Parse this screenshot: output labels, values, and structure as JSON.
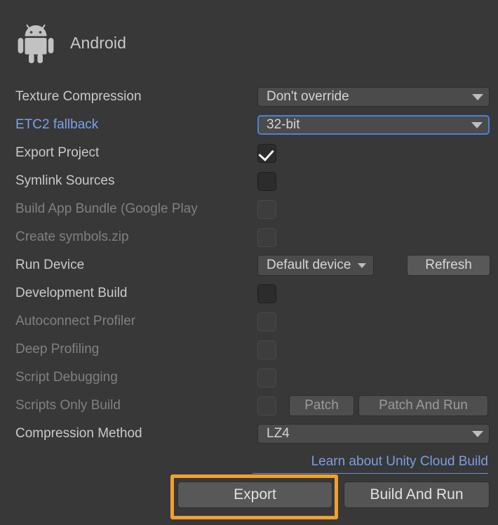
{
  "header": {
    "icon": "android-robot-icon",
    "title": "Android"
  },
  "settings": [
    {
      "label": "Texture Compression",
      "type": "dropdown",
      "value": "Don't override",
      "disabled": false,
      "label_style": "normal",
      "focused": false
    },
    {
      "label": "ETC2 fallback",
      "type": "dropdown",
      "value": "32-bit",
      "disabled": false,
      "label_style": "link",
      "focused": true
    },
    {
      "label": "Export Project",
      "type": "checkbox",
      "checked": true,
      "disabled": false,
      "label_style": "normal"
    },
    {
      "label": "Symlink Sources",
      "type": "checkbox",
      "checked": false,
      "disabled": false,
      "label_style": "normal"
    },
    {
      "label": "Build App Bundle (Google Play",
      "type": "checkbox",
      "checked": false,
      "disabled": true,
      "label_style": "disabled"
    },
    {
      "label": "Create symbols.zip",
      "type": "checkbox",
      "checked": false,
      "disabled": true,
      "label_style": "disabled"
    },
    {
      "label": "Run Device",
      "type": "device",
      "value": "Default device",
      "button": "Refresh",
      "disabled": false,
      "label_style": "normal"
    },
    {
      "label": "Development Build",
      "type": "checkbox",
      "checked": false,
      "disabled": false,
      "label_style": "normal"
    },
    {
      "label": "Autoconnect Profiler",
      "type": "checkbox",
      "checked": false,
      "disabled": true,
      "label_style": "disabled"
    },
    {
      "label": "Deep Profiling",
      "type": "checkbox",
      "checked": false,
      "disabled": true,
      "label_style": "disabled"
    },
    {
      "label": "Script Debugging",
      "type": "checkbox",
      "checked": false,
      "disabled": true,
      "label_style": "disabled"
    },
    {
      "label": "Scripts Only Build",
      "type": "patch",
      "checked": false,
      "patch_label": "Patch",
      "patch_run_label": "Patch And Run",
      "disabled": true,
      "label_style": "disabled"
    },
    {
      "label": "Compression Method",
      "type": "dropdown",
      "value": "LZ4",
      "disabled": false,
      "label_style": "normal",
      "focused": false
    }
  ],
  "cloud_build": {
    "link_label": "Learn about Unity Cloud Build"
  },
  "bottom": {
    "export_label": "Export",
    "build_and_run_label": "Build And Run"
  },
  "annotation": {
    "target": "export-button",
    "color": "#f0a030"
  },
  "colors": {
    "background": "#383838",
    "label": "#c9c9c9",
    "label_disabled": "#808080",
    "link": "#7aa2e8",
    "field_background": "#4b4b4b",
    "button_background": "#585858",
    "focus_border": "#4a83d8",
    "highlight": "#f0a030"
  }
}
